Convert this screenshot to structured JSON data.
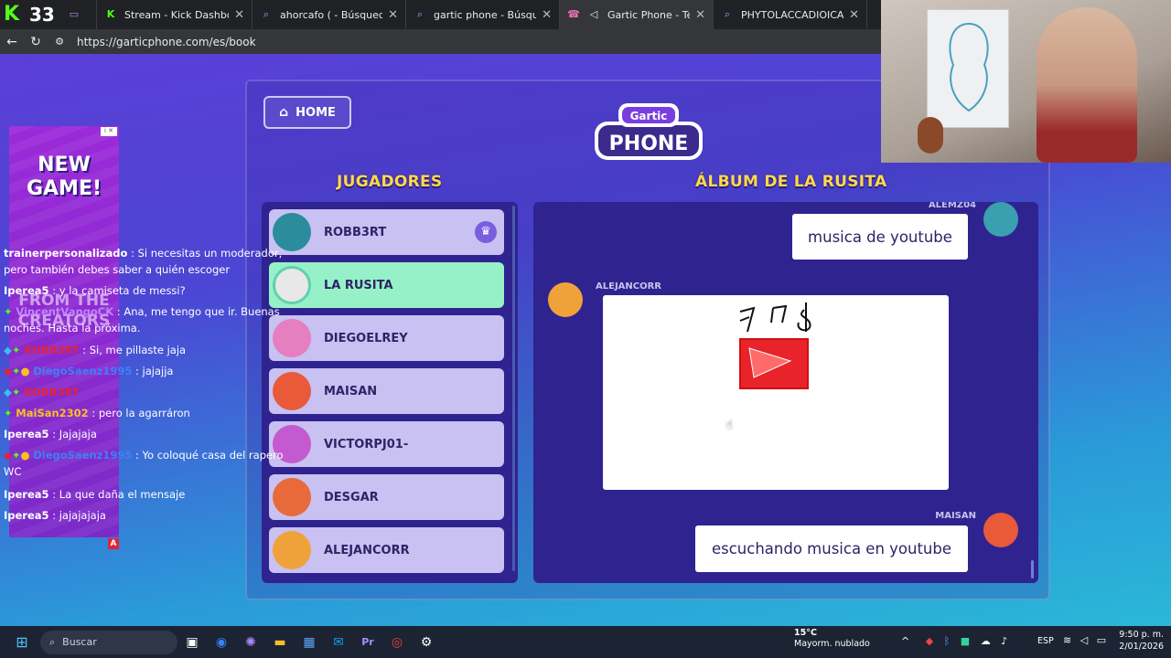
{
  "browser": {
    "tab_count": "33",
    "tabs": [
      {
        "label": "",
        "icon": "tv-icon"
      },
      {
        "label": "Stream - Kick Dashboard",
        "icon": "kick-icon"
      },
      {
        "label": "ahorcafo ( - Búsqueda",
        "icon": "search-icon"
      },
      {
        "label": "gartic phone - Búsqueda",
        "icon": "search-icon"
      },
      {
        "label": "Gartic Phone - Teléfono De",
        "icon": "phone-icon"
      },
      {
        "label": "PHYTOLACCADIOICA - Búsque",
        "icon": "search-icon"
      }
    ],
    "url": "https://garticphone.com/es/book"
  },
  "game": {
    "home_label": "HOME",
    "logo_top": "Gartic",
    "logo_bottom": "PHONE",
    "players_header": "JUGADORES",
    "album_header": "ÁLBUM DE LA RUSITA",
    "players": [
      {
        "name": "ROBB3RT",
        "color": "#2a8c9c"
      },
      {
        "name": "LA RUSITA",
        "color": "#5fd1b0"
      },
      {
        "name": "DIEGOELREY",
        "color": "#e57fbf"
      },
      {
        "name": "MAISAN",
        "color": "#e85a3a"
      },
      {
        "name": "VICTORPJ01-",
        "color": "#c35ad0"
      },
      {
        "name": "DESGAR",
        "color": "#e86a3a"
      },
      {
        "name": "ALEJANCORR",
        "color": "#f0a23a"
      }
    ],
    "album": {
      "entry1_author": "ALEMZ04",
      "entry1_text": "musica de youtube",
      "entry2_author": "ALEJANCORR",
      "entry3_author": "MAISAN",
      "entry3_text": "escuchando musica en youtube"
    }
  },
  "chat": [
    {
      "user": "trainerpersonalizado",
      "text": ": Si necesitas un moderador, pero también debes saber a quién escoger"
    },
    {
      "user": "Iperea5",
      "text": ": y la camiseta de messi?"
    },
    {
      "user": "VincentVangoCK",
      "text": ": Ana, me tengo que ir. Buenas noches. Hasta la próxima."
    },
    {
      "user": "ROBB3RT",
      "text": ": Si, me pillaste jaja"
    },
    {
      "user": "DiegoSaenz1995",
      "text": ": jajajja"
    },
    {
      "user": "ROBB3RT",
      "text": ""
    },
    {
      "user": "MaiSan2302",
      "text": ": pero la agarráron"
    },
    {
      "user": "Iperea5",
      "text": ": Jajajaja"
    },
    {
      "user": "DiegoSaenz1995",
      "text": ": Yo coloqué casa del rapero WC"
    },
    {
      "user": "Iperea5",
      "text": ": La que daña el mensaje"
    },
    {
      "user": "Iperea5",
      "text": ": jajajajaja"
    }
  ],
  "ad": {
    "line1": "NEW",
    "line2": "GAME!",
    "line3": "FROM THE",
    "line4": "CREATORS"
  },
  "taskbar": {
    "search_label": "Buscar",
    "temp": "15°C",
    "weather": "Mayorm. nublado",
    "lang": "ESP",
    "time": "9:50 p. m.",
    "date": "2/01/2026"
  }
}
